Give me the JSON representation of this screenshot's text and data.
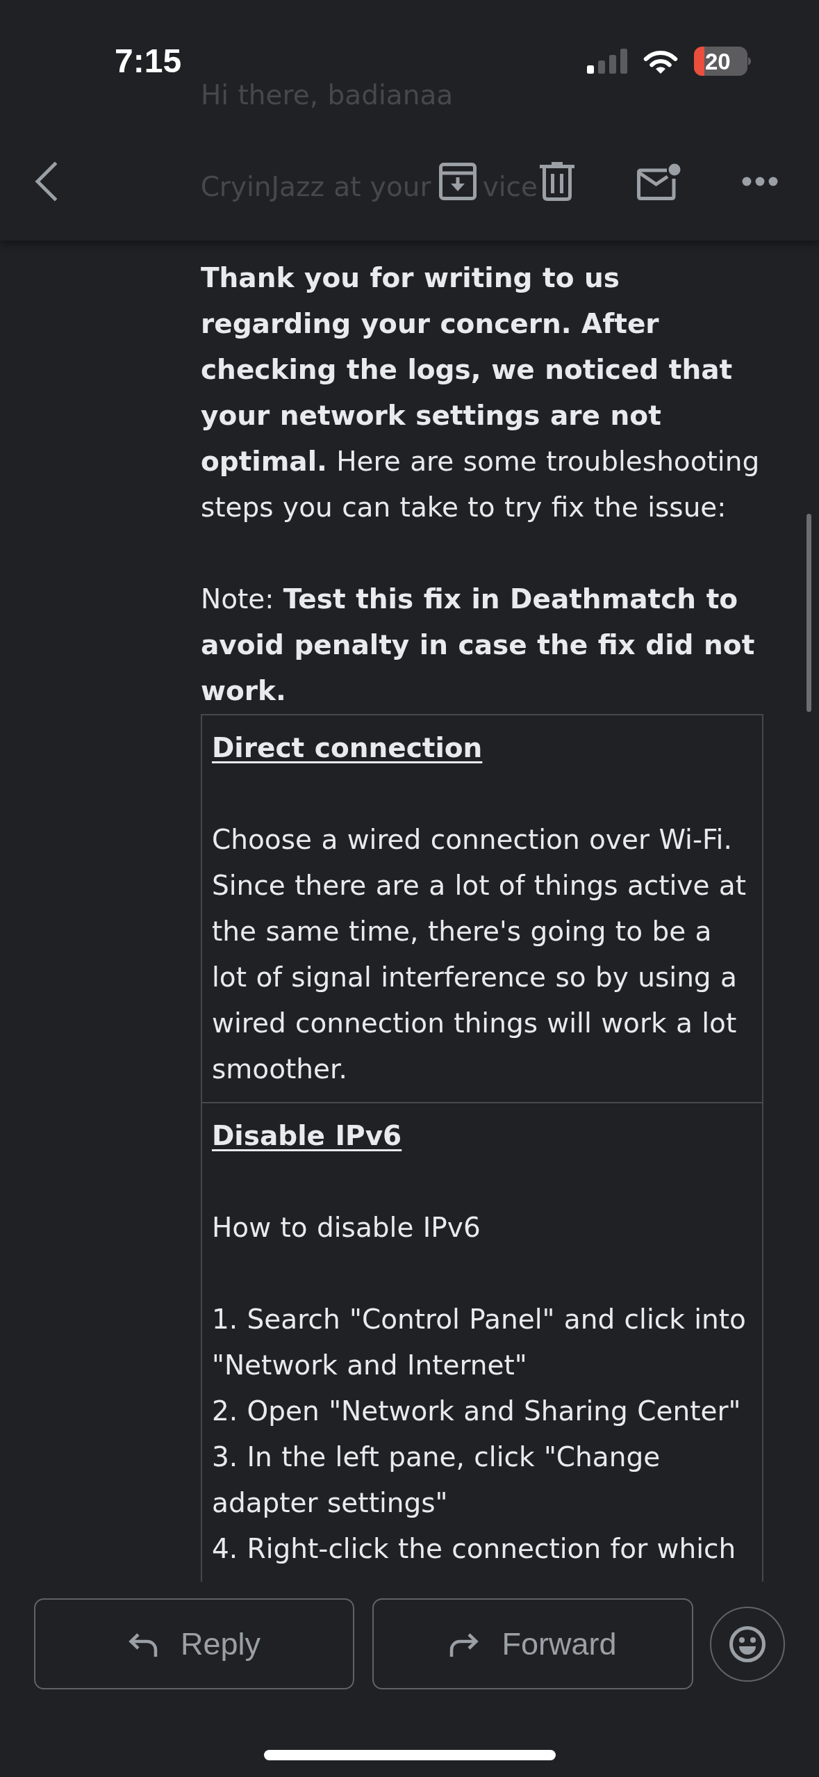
{
  "status_bar": {
    "time": "7:15",
    "battery": "20"
  },
  "email": {
    "faded_lines": [
      "Hi there, badianaa",
      "CryinJazz at your",
      "vice"
    ],
    "paragraphs": [
      "**Thank you for writing to us regarding your concern. After checking the logs, we noticed that your network settings are not optimal.** Here are some troubleshooting steps you can take to try fix the issue:",
      "Note: **Test this fix in Deathmatch to avoid penalty in case the fix did not work.**"
    ],
    "table": {
      "rows": [
        {
          "heading": "Direct connection",
          "blocks": [
            [
              "Choose a wired connection over Wi-Fi. Since there are a lot of things active at the same time, there's going to be a lot of signal interference so by using a wired connection things will work a lot smoother."
            ]
          ]
        },
        {
          "heading": "Disable IPv6",
          "blocks": [
            [
              "How to disable IPv6"
            ],
            [
              "1. Search \"Control Panel\" and click into \"Network and Internet\"",
              "2. Open \"Network and Sharing Center\"",
              "3. In the left pane, click \"Change adapter settings\"",
              "4. Right-click the connection for which"
            ]
          ]
        }
      ]
    }
  },
  "actions": [
    {
      "kind": "reply",
      "label": "Reply"
    },
    {
      "kind": "forward",
      "label": "Forward"
    }
  ]
}
